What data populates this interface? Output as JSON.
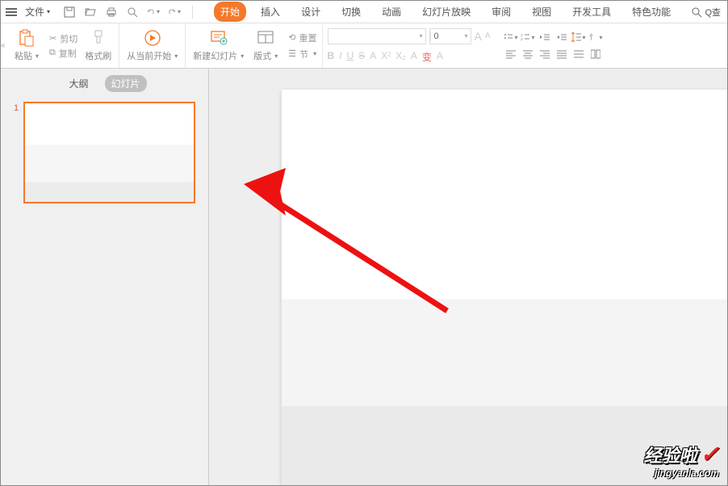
{
  "file_menu": "文件",
  "tabs": [
    "开始",
    "插入",
    "设计",
    "切换",
    "动画",
    "幻灯片放映",
    "审阅",
    "视图",
    "开发工具",
    "特色功能"
  ],
  "active_tab_index": 0,
  "search_hint": "Q查",
  "ribbon": {
    "paste_label": "粘贴",
    "cut": "剪切",
    "copy": "复制",
    "format_painter": "格式刷",
    "from_current": "从当前开始",
    "new_slide": "新建幻灯片",
    "layout": "版式",
    "reset": "重置",
    "section": "节",
    "font_size_value": "0",
    "font_buttons": [
      "B",
      "I",
      "U",
      "S",
      "A",
      "X²",
      "X₂",
      "A",
      "变",
      "A"
    ],
    "aa_large": "A",
    "aa_small": "A"
  },
  "side": {
    "outline": "大纲",
    "slides": "幻灯片",
    "thumb_number": "1"
  },
  "watermark": {
    "main": "经验啦",
    "sub": "jingyanla.com"
  }
}
